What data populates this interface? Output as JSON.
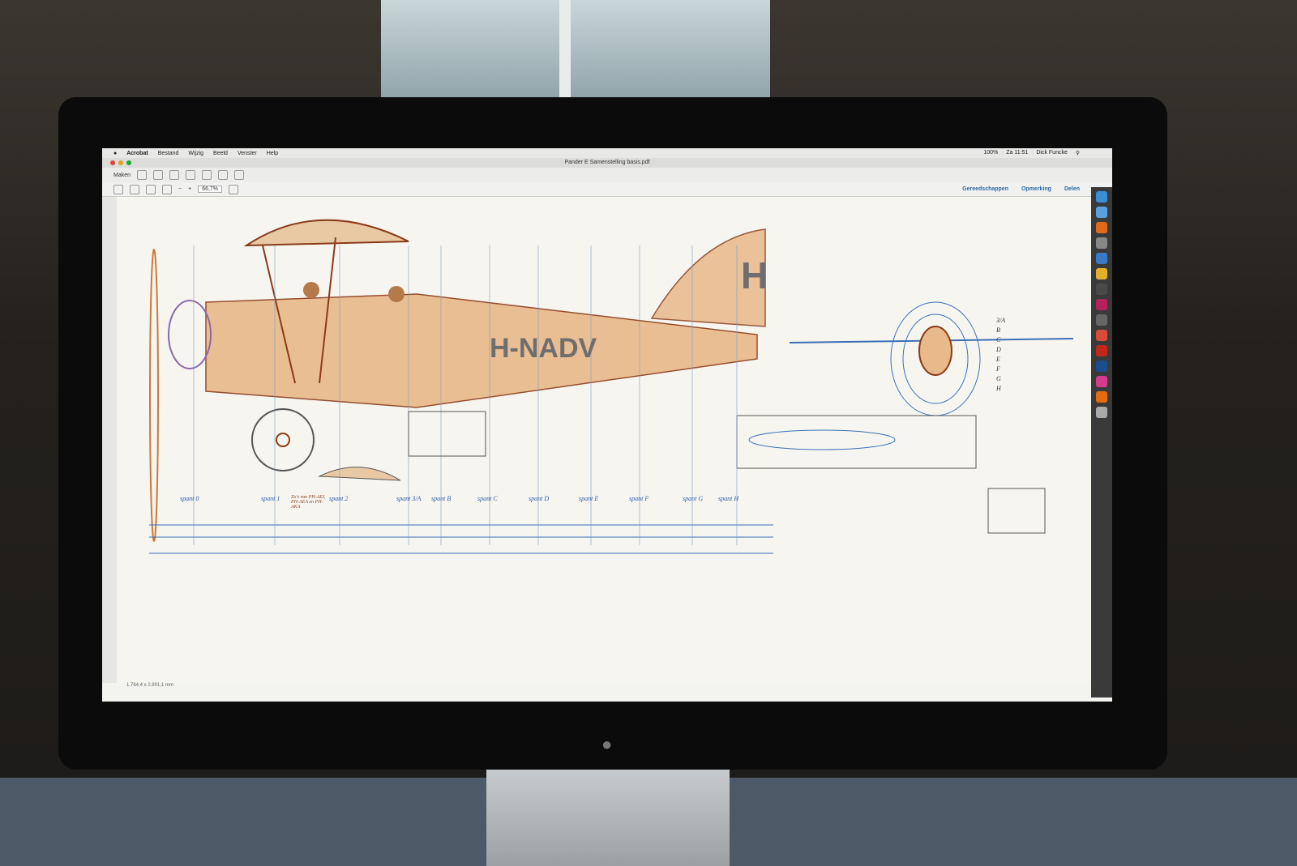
{
  "menubar": {
    "apple": "",
    "items": [
      "Acrobat",
      "Bestand",
      "Wijzig",
      "Beeld",
      "Venster",
      "Help"
    ],
    "battery": "100%",
    "clock": "Za 11:51",
    "user": "Dick Funcke"
  },
  "window": {
    "title": "Pander E Samenstelling basis.pdf"
  },
  "toolbar": {
    "create_label": "Maken",
    "zoom_value": "66,7%",
    "tools_label": "Gereedschappen",
    "comment_label": "Opmerking",
    "share_label": "Delen"
  },
  "drawing": {
    "registration_main": "H-NADV",
    "registration_tail": "H",
    "section_letters": [
      "3/A",
      "B",
      "C",
      "D",
      "E",
      "F",
      "G",
      "H"
    ],
    "spant_labels": [
      "spant 0",
      "spant 1",
      "spant 2",
      "spant 3/A",
      "spant B",
      "spant C",
      "spant D",
      "spant E",
      "spant F",
      "spant G",
      "spant H"
    ],
    "note": "Zo's van PH-AEI, PH-AEA en PH-AKA"
  },
  "statusbar": {
    "page_size": "1.764,4 x 2.801,1 mm"
  },
  "colors": {
    "fuselage": "#e8b98a",
    "linework": "#3b6fb6",
    "frame": "#8a3b1a"
  }
}
